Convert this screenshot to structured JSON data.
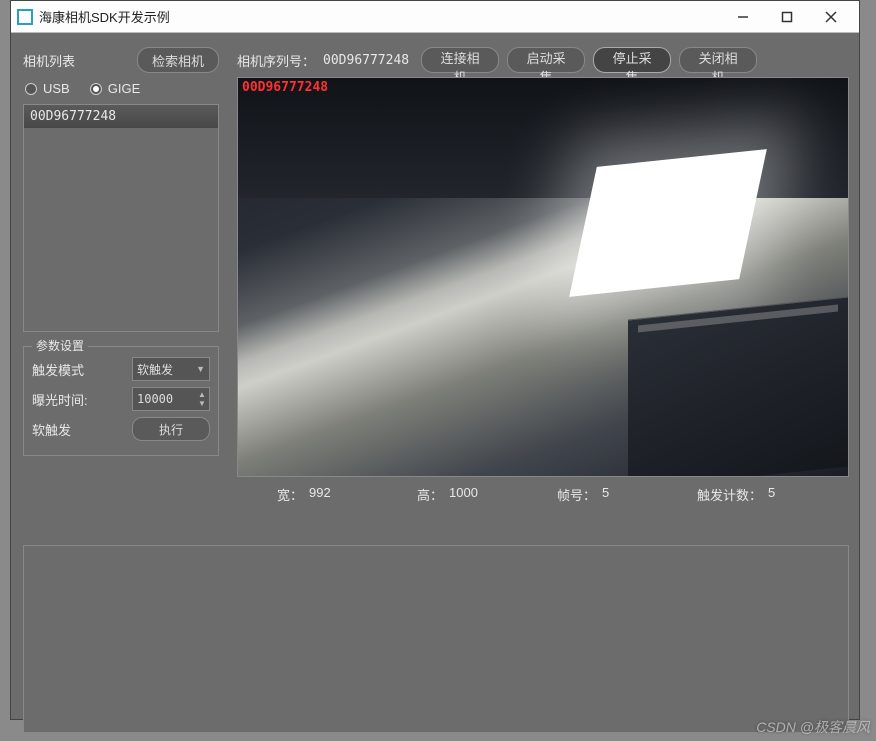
{
  "window": {
    "title": "海康相机SDK开发示例"
  },
  "left": {
    "list_label": "相机列表",
    "search_btn": "检索相机",
    "radio_usb": "USB",
    "radio_gige": "GIGE",
    "selected_radio": "GIGE",
    "camera_items": [
      "00D96777248"
    ]
  },
  "params": {
    "title": "参数设置",
    "trigger_mode_label": "触发模式",
    "trigger_mode_value": "软触发",
    "exposure_label": "曝光时间:",
    "exposure_value": "10000",
    "soft_trigger_label": "软触发",
    "execute_btn": "执行"
  },
  "top": {
    "serial_label": "相机序列号：",
    "serial_value": "00D96777248",
    "connect_btn": "连接相机",
    "start_btn": "启动采集",
    "stop_btn": "停止采集",
    "close_btn": "关闭相机"
  },
  "overlay": {
    "text": "00D96777248"
  },
  "stats": {
    "width_label": "宽：",
    "width_value": "992",
    "height_label": "高：",
    "height_value": "1000",
    "frame_label": "帧号：",
    "frame_value": "5",
    "trigger_count_label": "触发计数：",
    "trigger_count_value": "5"
  },
  "watermark": "CSDN @极客晨风"
}
